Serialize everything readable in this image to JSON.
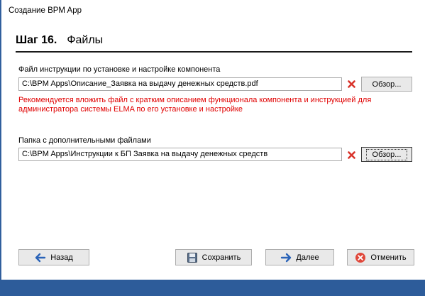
{
  "window": {
    "title": "Создание BPM App"
  },
  "step": {
    "number": "Шаг 16.",
    "name": "Файлы"
  },
  "instruction_file": {
    "label": "Файл инструкции по установке и настройке компонента",
    "value": "C:\\BPM Apps\\Описание_Заявка на выдачу денежных средств.pdf",
    "browse_label": "Обзор...",
    "warning": "Рекомендуется вложить файл с кратким описанием функционала компонента и инструкцией для администратора системы ELMA по его установке и настройке"
  },
  "extra_folder": {
    "label": "Папка с дополнительными файлами",
    "value": "C:\\BPM Apps\\Инструкции к БП Заявка на выдачу денежных средств",
    "browse_label": "Обзор..."
  },
  "buttons": {
    "back": "Назад",
    "save": "Сохранить",
    "next": "Далее",
    "cancel": "Отменить"
  },
  "colors": {
    "accent_blue": "#2d5c9a",
    "warning_red": "#e00000",
    "delete_red": "#d9342b"
  },
  "icons": {
    "back": "arrow-left-icon",
    "save": "floppy-disk-icon",
    "next": "arrow-right-icon",
    "cancel": "cancel-circle-icon",
    "delete": "x-icon"
  }
}
